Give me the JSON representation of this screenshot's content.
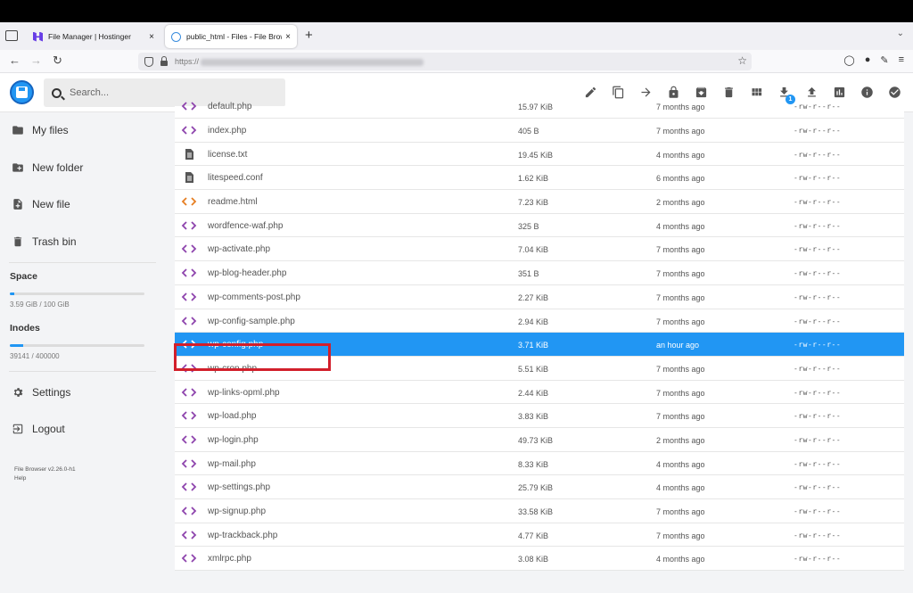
{
  "browser": {
    "tabs": [
      {
        "title": "File Manager | Hostinger",
        "close": "×"
      },
      {
        "title": "public_html - Files - File Browser",
        "close": "×"
      }
    ],
    "new_tab": "+",
    "url_prefix": "https://"
  },
  "app": {
    "search_placeholder": "Search...",
    "notification_count": "1",
    "actions": [
      "edit",
      "copy",
      "move",
      "permissions",
      "archive",
      "delete",
      "grid-view",
      "download",
      "upload",
      "disk-usage",
      "info",
      "select"
    ]
  },
  "sidebar": {
    "items": [
      {
        "label": "My files",
        "icon": "folder-icon"
      },
      {
        "label": "New folder",
        "icon": "new-folder-icon"
      },
      {
        "label": "New file",
        "icon": "new-file-icon"
      },
      {
        "label": "Trash bin",
        "icon": "trash-icon"
      }
    ],
    "space": {
      "title": "Space",
      "text": "3.59 GiB / 100 GiB",
      "fraction": 0.036
    },
    "inodes": {
      "title": "Inodes",
      "text": "39141 / 400000",
      "fraction": 0.098
    },
    "settings": "Settings",
    "logout": "Logout",
    "version": "File Browser v2.26.0-h1",
    "help": "Help"
  },
  "files": [
    {
      "name": "default.php",
      "size": "15.97 KiB",
      "modified": "7 months ago",
      "perm": "-rw-r--r--",
      "type": "code"
    },
    {
      "name": "index.php",
      "size": "405 B",
      "modified": "7 months ago",
      "perm": "-rw-r--r--",
      "type": "code"
    },
    {
      "name": "license.txt",
      "size": "19.45 KiB",
      "modified": "4 months ago",
      "perm": "-rw-r--r--",
      "type": "text"
    },
    {
      "name": "litespeed.conf",
      "size": "1.62 KiB",
      "modified": "6 months ago",
      "perm": "-rw-r--r--",
      "type": "text"
    },
    {
      "name": "readme.html",
      "size": "7.23 KiB",
      "modified": "2 months ago",
      "perm": "-rw-r--r--",
      "type": "html"
    },
    {
      "name": "wordfence-waf.php",
      "size": "325 B",
      "modified": "4 months ago",
      "perm": "-rw-r--r--",
      "type": "code"
    },
    {
      "name": "wp-activate.php",
      "size": "7.04 KiB",
      "modified": "7 months ago",
      "perm": "-rw-r--r--",
      "type": "code"
    },
    {
      "name": "wp-blog-header.php",
      "size": "351 B",
      "modified": "7 months ago",
      "perm": "-rw-r--r--",
      "type": "code"
    },
    {
      "name": "wp-comments-post.php",
      "size": "2.27 KiB",
      "modified": "7 months ago",
      "perm": "-rw-r--r--",
      "type": "code"
    },
    {
      "name": "wp-config-sample.php",
      "size": "2.94 KiB",
      "modified": "7 months ago",
      "perm": "-rw-r--r--",
      "type": "code"
    },
    {
      "name": "wp-config.php",
      "size": "3.71 KiB",
      "modified": "an hour ago",
      "perm": "-rw-r--r--",
      "type": "code",
      "selected": true
    },
    {
      "name": "wp-cron.php",
      "size": "5.51 KiB",
      "modified": "7 months ago",
      "perm": "-rw-r--r--",
      "type": "code"
    },
    {
      "name": "wp-links-opml.php",
      "size": "2.44 KiB",
      "modified": "7 months ago",
      "perm": "-rw-r--r--",
      "type": "code"
    },
    {
      "name": "wp-load.php",
      "size": "3.83 KiB",
      "modified": "7 months ago",
      "perm": "-rw-r--r--",
      "type": "code"
    },
    {
      "name": "wp-login.php",
      "size": "49.73 KiB",
      "modified": "2 months ago",
      "perm": "-rw-r--r--",
      "type": "code"
    },
    {
      "name": "wp-mail.php",
      "size": "8.33 KiB",
      "modified": "4 months ago",
      "perm": "-rw-r--r--",
      "type": "code"
    },
    {
      "name": "wp-settings.php",
      "size": "25.79 KiB",
      "modified": "4 months ago",
      "perm": "-rw-r--r--",
      "type": "code"
    },
    {
      "name": "wp-signup.php",
      "size": "33.58 KiB",
      "modified": "7 months ago",
      "perm": "-rw-r--r--",
      "type": "code"
    },
    {
      "name": "wp-trackback.php",
      "size": "4.77 KiB",
      "modified": "7 months ago",
      "perm": "-rw-r--r--",
      "type": "code"
    },
    {
      "name": "xmlrpc.php",
      "size": "3.08 KiB",
      "modified": "4 months ago",
      "perm": "-rw-r--r--",
      "type": "code"
    }
  ],
  "colors": {
    "accent": "#2196f3",
    "code_icon": "#8e44ad",
    "html_icon": "#e67e22",
    "highlight": "#d21f2b"
  }
}
